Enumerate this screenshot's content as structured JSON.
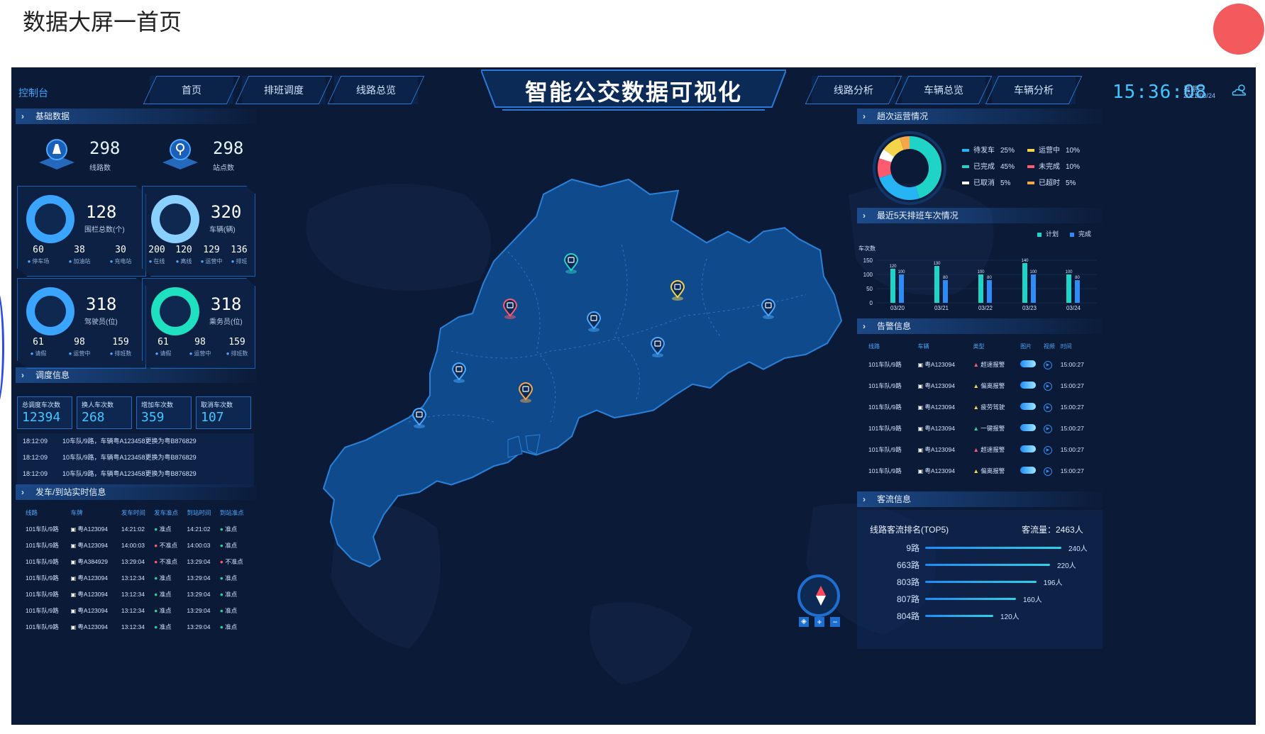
{
  "caption": "数据大屏一首页",
  "header": {
    "console": "控制台",
    "tabs_left": [
      "首页",
      "排班调度",
      "线路总览"
    ],
    "title": "智能公交数据可视化",
    "tabs_right": [
      "线路分析",
      "车辆总览",
      "车辆分析"
    ],
    "time": "15:36:08",
    "weekday": "星期三",
    "date": "2021/03/24",
    "weather_icon": "cloud-sun-icon"
  },
  "basic": {
    "title": "基础数据",
    "routes": {
      "value": "298",
      "label": "线路数"
    },
    "stations": {
      "value": "298",
      "label": "站点数"
    },
    "fences": {
      "value": "128",
      "label": "围栏总数(个)",
      "subs": [
        {
          "v": "60",
          "l": "停车场"
        },
        {
          "v": "38",
          "l": "加油站"
        },
        {
          "v": "30",
          "l": "充电站"
        }
      ]
    },
    "vehicles": {
      "value": "320",
      "label": "车辆(辆)",
      "subs": [
        {
          "v": "200",
          "l": "在线"
        },
        {
          "v": "120",
          "l": "离线"
        },
        {
          "v": "129",
          "l": "运营中"
        },
        {
          "v": "136",
          "l": "排班"
        }
      ]
    },
    "drivers": {
      "value": "318",
      "label": "驾驶员(位)",
      "subs": [
        {
          "v": "61",
          "l": "请假"
        },
        {
          "v": "98",
          "l": "运营中"
        },
        {
          "v": "159",
          "l": "排班数"
        }
      ]
    },
    "crew": {
      "value": "318",
      "label": "乘务员(位)",
      "subs": [
        {
          "v": "61",
          "l": "请假"
        },
        {
          "v": "98",
          "l": "运营中"
        },
        {
          "v": "159",
          "l": "排班数"
        }
      ]
    }
  },
  "dispatch": {
    "title": "调度信息",
    "boxes": [
      {
        "t": "总调度车次数",
        "n": "12394"
      },
      {
        "t": "换人车次数",
        "n": "268"
      },
      {
        "t": "增加车次数",
        "n": "359"
      },
      {
        "t": "取消车次数",
        "n": "107"
      }
    ],
    "logs": [
      {
        "time": "18:12:09",
        "text": "10车队/9路，车辆粤A123458更换为粤B876829"
      },
      {
        "time": "18:12:09",
        "text": "10车队/9路，车辆粤A123458更换为粤B876829"
      },
      {
        "time": "18:12:09",
        "text": "10车队/9路，车辆粤A123458更换为粤B876829"
      }
    ]
  },
  "realtime": {
    "title": "发车/到站实时信息",
    "headers": [
      "线路",
      "车牌",
      "发车时间",
      "发车准点",
      "到站时间",
      "到站准点"
    ],
    "rows": [
      [
        "101车队/9路",
        "粤A123094",
        "14:21:02",
        "准点",
        "14:21:02",
        "准点"
      ],
      [
        "101车队/9路",
        "粤A123094",
        "14:00:03",
        "不准点",
        "14:00:03",
        "准点"
      ],
      [
        "101车队/9路",
        "粤A384929",
        "13:29:04",
        "不准点",
        "13:29:04",
        "不准点"
      ],
      [
        "101车队/9路",
        "粤A123094",
        "13:12:34",
        "准点",
        "13:29:04",
        "准点"
      ],
      [
        "101车队/9路",
        "粤A123094",
        "13:12:34",
        "准点",
        "13:29:04",
        "准点"
      ],
      [
        "101车队/9路",
        "粤A123094",
        "13:12:34",
        "准点",
        "13:29:04",
        "准点"
      ],
      [
        "101车队/9路",
        "粤A123094",
        "13:12:34",
        "准点",
        "13:29:04",
        "准点"
      ]
    ]
  },
  "trips": {
    "title": "趟次运营情况",
    "legend": [
      {
        "name": "待发车",
        "pct": "25%",
        "value": 25,
        "color": "#27b4f5"
      },
      {
        "name": "运营中",
        "pct": "10%",
        "value": 10,
        "color": "#f5d34a"
      },
      {
        "name": "已完成",
        "pct": "45%",
        "value": 45,
        "color": "#1fd3c6"
      },
      {
        "name": "未完成",
        "pct": "10%",
        "value": 10,
        "color": "#ff5a6e"
      },
      {
        "name": "已取消",
        "pct": "5%",
        "value": 5,
        "color": "#ffffff"
      },
      {
        "name": "已超时",
        "pct": "5%",
        "value": 5,
        "color": "#f5a54a"
      }
    ]
  },
  "chart_data": {
    "type": "bar",
    "title": "最近5天排班车次情况",
    "ylabel": "车次数",
    "categories": [
      "03/20",
      "03/21",
      "03/22",
      "03/23",
      "03/24"
    ],
    "series": [
      {
        "name": "计划",
        "values": [
          120,
          130,
          100,
          140,
          100
        ],
        "color": "#1fd3c6"
      },
      {
        "name": "完成",
        "values": [
          100,
          80,
          80,
          100,
          80
        ],
        "color": "#2f8cf5"
      }
    ],
    "ylim": [
      0,
      150
    ],
    "yticks": [
      0,
      50,
      100,
      150
    ]
  },
  "alerts": {
    "title": "告警信息",
    "headers": [
      "线路",
      "车辆",
      "类型",
      "图片",
      "视频",
      "时间"
    ],
    "rows": [
      {
        "line": "101车队/9路",
        "car": "粤A123094",
        "type": "超速报警",
        "color": "#ff5a6e",
        "time": "15:00:27"
      },
      {
        "line": "101车队/9路",
        "car": "粤A123094",
        "type": "偏离报警",
        "color": "#f5d34a",
        "time": "15:00:27"
      },
      {
        "line": "101车队/9路",
        "car": "粤A123094",
        "type": "疲劳驾驶",
        "color": "#f5d34a",
        "time": "15:00:27"
      },
      {
        "line": "101车队/9路",
        "car": "粤A123094",
        "type": "一键报警",
        "color": "#27d39a",
        "time": "15:00:27"
      },
      {
        "line": "101车队/9路",
        "car": "粤A123094",
        "type": "超速报警",
        "color": "#ff5a6e",
        "time": "15:00:27"
      },
      {
        "line": "101车队/9路",
        "car": "粤A123094",
        "type": "偏离报警",
        "color": "#f5d34a",
        "time": "15:00:27"
      }
    ]
  },
  "flow": {
    "title": "客流信息",
    "subtitle": "线路客流排名(TOP5)",
    "total": "客流量：2463人",
    "items": [
      {
        "name": "9路",
        "value": 240,
        "label": "240人"
      },
      {
        "name": "663路",
        "value": 220,
        "label": "220人"
      },
      {
        "name": "803路",
        "value": 196,
        "label": "196人"
      },
      {
        "name": "807路",
        "value": 160,
        "label": "160人"
      },
      {
        "name": "804路",
        "value": 120,
        "label": "120人"
      }
    ]
  },
  "map": {
    "markers": [
      {
        "color": "#2fd0c8"
      },
      {
        "color": "#ff5a6e"
      },
      {
        "color": "#4aa8ff"
      },
      {
        "color": "#f5d34a"
      },
      {
        "color": "#4aa8ff"
      },
      {
        "color": "#4aa8ff"
      },
      {
        "color": "#4aa8ff"
      },
      {
        "color": "#f5a54a"
      },
      {
        "color": "#4aa8ff"
      }
    ]
  }
}
